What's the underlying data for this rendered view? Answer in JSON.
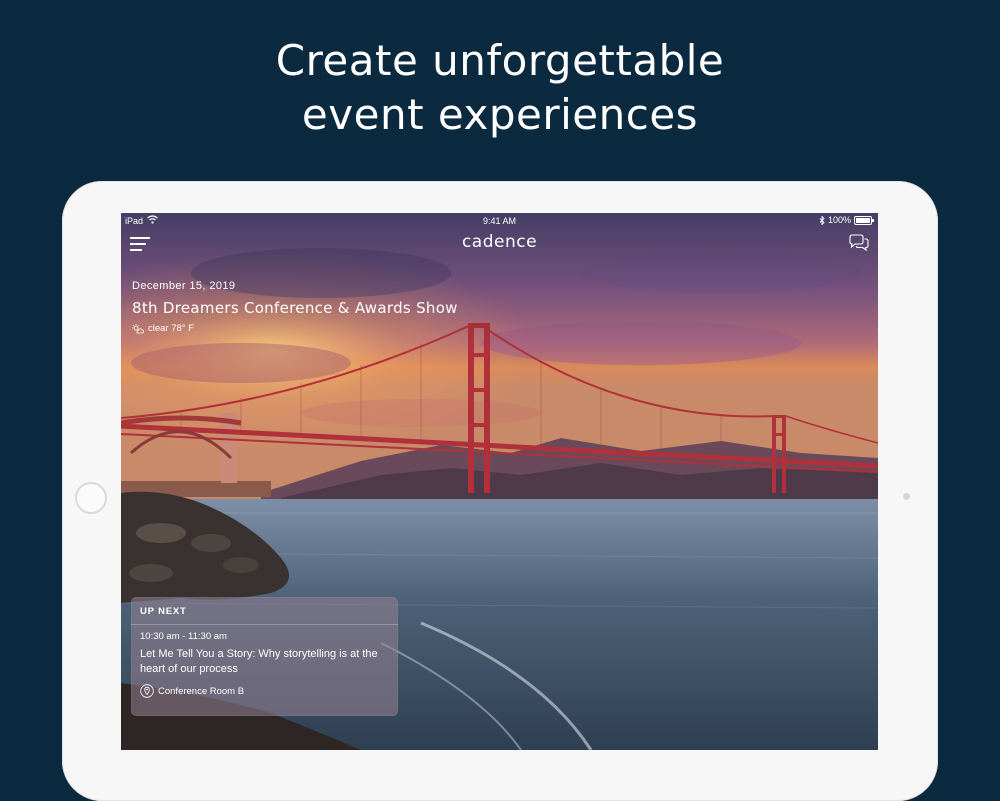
{
  "promo": {
    "headline_line1": "Create unforgettable",
    "headline_line2": "event experiences"
  },
  "status_bar": {
    "device": "iPad",
    "time": "9:41 AM",
    "battery": "100%",
    "icons": [
      "wifi-icon",
      "bluetooth-icon",
      "battery-icon"
    ]
  },
  "app_bar": {
    "brand": "cadence",
    "left_icon": "hamburger-menu-icon",
    "right_icon": "chat-bubbles-icon"
  },
  "event": {
    "date": "December 15, 2019",
    "title": "8th Dreamers Conference & Awards Show",
    "weather": "clear 78° F",
    "weather_icon": "partly-sunny-icon"
  },
  "up_next": {
    "label": "UP NEXT",
    "time": "10:30 am - 11:30 am",
    "title": "Let Me Tell You a Story: Why storytelling is at the heart of our process",
    "location": "Conference Room B",
    "location_icon": "location-pin-icon"
  },
  "colors": {
    "background": "#0b2a3f",
    "device_frame": "#f7f7f7",
    "bridge": "#b0313a",
    "text": "#ffffff"
  }
}
